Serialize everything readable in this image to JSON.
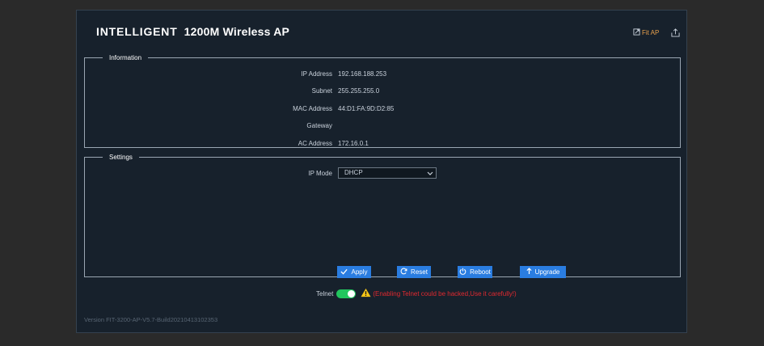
{
  "header": {
    "brand": "INTELLIGENT",
    "title_rest": "1200M Wireless AP",
    "fit_ap_label": "Fit AP"
  },
  "information": {
    "legend": "Information",
    "rows": [
      {
        "label": "IP Address",
        "value": "192.168.188.253"
      },
      {
        "label": "Subnet",
        "value": "255.255.255.0"
      },
      {
        "label": "MAC Address",
        "value": "44:D1:FA:9D:D2:85"
      },
      {
        "label": "Gateway",
        "value": ""
      },
      {
        "label": "AC Address",
        "value": "172.16.0.1"
      }
    ]
  },
  "settings": {
    "legend": "Settings",
    "ip_mode_label": "IP Mode",
    "ip_mode_value": "DHCP",
    "buttons": {
      "apply": "Apply",
      "reset": "Reset",
      "reboot": "Reboot",
      "upgrade": "Upgrade"
    }
  },
  "telnet": {
    "label": "Telnet",
    "enabled": true,
    "warning": "(Enabling Telnet could be hacked,Use it carefully!)"
  },
  "version": "Version FIT-3200-AP-V5.7-Build20210413102353",
  "colors": {
    "panel_bg": "#17212c",
    "accent_button": "#2a7de1",
    "toggle_on": "#22c55e",
    "warning": "#e2292f",
    "fit_ap": "#e7a04c"
  },
  "icons": [
    "fit-ap-icon",
    "export-icon",
    "checkmark-icon",
    "refresh-icon",
    "power-icon",
    "upload-arrow-icon",
    "warning-icon",
    "chevron-down-icon"
  ]
}
